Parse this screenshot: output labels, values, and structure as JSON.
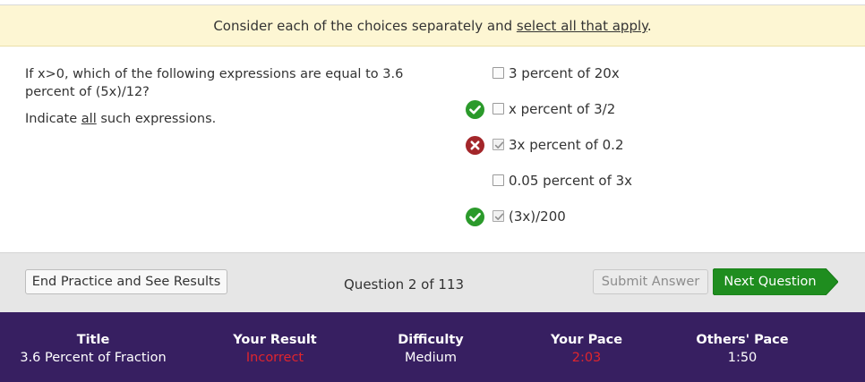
{
  "instruction": {
    "prefix": "Consider each of the choices separately and ",
    "link": "select all that apply",
    "suffix": "."
  },
  "question": {
    "text": "If x>0, which of the following expressions are equal to 3.6 percent of (5x)/12?",
    "indicate_prefix": "Indicate ",
    "indicate_emph": "all",
    "indicate_suffix": " such expressions."
  },
  "choices": [
    {
      "label": "3 percent of 20x",
      "checked": false,
      "status": "none"
    },
    {
      "label": "x percent of 3/2",
      "checked": false,
      "status": "correct"
    },
    {
      "label": "3x percent of 0.2",
      "checked": true,
      "status": "incorrect"
    },
    {
      "label": "0.05 percent of 3x",
      "checked": false,
      "status": "none"
    },
    {
      "label": "(3x)/200",
      "checked": true,
      "status": "correct"
    }
  ],
  "controls": {
    "end_label": "End Practice and See Results",
    "question_counter": "Question 2 of 113",
    "submit_label": "Submit Answer",
    "next_label": "Next Question"
  },
  "footer": {
    "title": {
      "heading": "Title",
      "value": "3.6 Percent of Fraction"
    },
    "result": {
      "heading": "Your Result",
      "value": "Incorrect"
    },
    "difficulty": {
      "heading": "Difficulty",
      "value": "Medium"
    },
    "your_pace": {
      "heading": "Your Pace",
      "value": "2:03"
    },
    "others_pace": {
      "heading": "Others' Pace",
      "value": "1:50"
    }
  },
  "colors": {
    "instruction_bg": "#fdf6d3",
    "correct": "#2b9a2b",
    "incorrect": "#a3262a",
    "next_button": "#1f8d1f",
    "footer_bg": "#371f61",
    "bad_value": "#e0252d"
  }
}
